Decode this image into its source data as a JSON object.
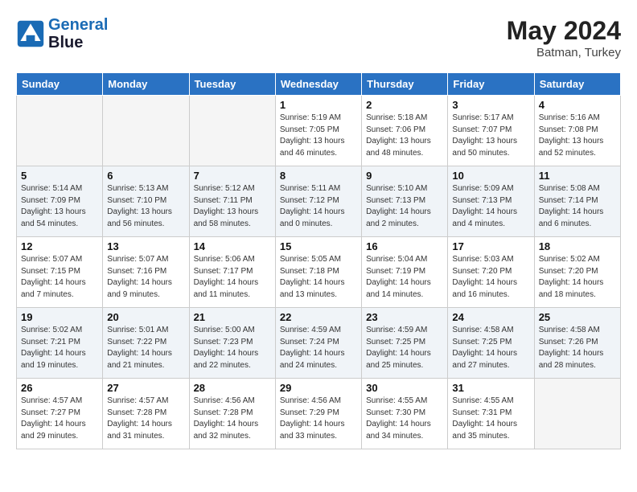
{
  "header": {
    "logo_line1": "General",
    "logo_line2": "Blue",
    "month_year": "May 2024",
    "location": "Batman, Turkey"
  },
  "weekdays": [
    "Sunday",
    "Monday",
    "Tuesday",
    "Wednesday",
    "Thursday",
    "Friday",
    "Saturday"
  ],
  "weeks": [
    [
      {
        "day": "",
        "info": ""
      },
      {
        "day": "",
        "info": ""
      },
      {
        "day": "",
        "info": ""
      },
      {
        "day": "1",
        "info": "Sunrise: 5:19 AM\nSunset: 7:05 PM\nDaylight: 13 hours\nand 46 minutes."
      },
      {
        "day": "2",
        "info": "Sunrise: 5:18 AM\nSunset: 7:06 PM\nDaylight: 13 hours\nand 48 minutes."
      },
      {
        "day": "3",
        "info": "Sunrise: 5:17 AM\nSunset: 7:07 PM\nDaylight: 13 hours\nand 50 minutes."
      },
      {
        "day": "4",
        "info": "Sunrise: 5:16 AM\nSunset: 7:08 PM\nDaylight: 13 hours\nand 52 minutes."
      }
    ],
    [
      {
        "day": "5",
        "info": "Sunrise: 5:14 AM\nSunset: 7:09 PM\nDaylight: 13 hours\nand 54 minutes."
      },
      {
        "day": "6",
        "info": "Sunrise: 5:13 AM\nSunset: 7:10 PM\nDaylight: 13 hours\nand 56 minutes."
      },
      {
        "day": "7",
        "info": "Sunrise: 5:12 AM\nSunset: 7:11 PM\nDaylight: 13 hours\nand 58 minutes."
      },
      {
        "day": "8",
        "info": "Sunrise: 5:11 AM\nSunset: 7:12 PM\nDaylight: 14 hours\nand 0 minutes."
      },
      {
        "day": "9",
        "info": "Sunrise: 5:10 AM\nSunset: 7:13 PM\nDaylight: 14 hours\nand 2 minutes."
      },
      {
        "day": "10",
        "info": "Sunrise: 5:09 AM\nSunset: 7:13 PM\nDaylight: 14 hours\nand 4 minutes."
      },
      {
        "day": "11",
        "info": "Sunrise: 5:08 AM\nSunset: 7:14 PM\nDaylight: 14 hours\nand 6 minutes."
      }
    ],
    [
      {
        "day": "12",
        "info": "Sunrise: 5:07 AM\nSunset: 7:15 PM\nDaylight: 14 hours\nand 7 minutes."
      },
      {
        "day": "13",
        "info": "Sunrise: 5:07 AM\nSunset: 7:16 PM\nDaylight: 14 hours\nand 9 minutes."
      },
      {
        "day": "14",
        "info": "Sunrise: 5:06 AM\nSunset: 7:17 PM\nDaylight: 14 hours\nand 11 minutes."
      },
      {
        "day": "15",
        "info": "Sunrise: 5:05 AM\nSunset: 7:18 PM\nDaylight: 14 hours\nand 13 minutes."
      },
      {
        "day": "16",
        "info": "Sunrise: 5:04 AM\nSunset: 7:19 PM\nDaylight: 14 hours\nand 14 minutes."
      },
      {
        "day": "17",
        "info": "Sunrise: 5:03 AM\nSunset: 7:20 PM\nDaylight: 14 hours\nand 16 minutes."
      },
      {
        "day": "18",
        "info": "Sunrise: 5:02 AM\nSunset: 7:20 PM\nDaylight: 14 hours\nand 18 minutes."
      }
    ],
    [
      {
        "day": "19",
        "info": "Sunrise: 5:02 AM\nSunset: 7:21 PM\nDaylight: 14 hours\nand 19 minutes."
      },
      {
        "day": "20",
        "info": "Sunrise: 5:01 AM\nSunset: 7:22 PM\nDaylight: 14 hours\nand 21 minutes."
      },
      {
        "day": "21",
        "info": "Sunrise: 5:00 AM\nSunset: 7:23 PM\nDaylight: 14 hours\nand 22 minutes."
      },
      {
        "day": "22",
        "info": "Sunrise: 4:59 AM\nSunset: 7:24 PM\nDaylight: 14 hours\nand 24 minutes."
      },
      {
        "day": "23",
        "info": "Sunrise: 4:59 AM\nSunset: 7:25 PM\nDaylight: 14 hours\nand 25 minutes."
      },
      {
        "day": "24",
        "info": "Sunrise: 4:58 AM\nSunset: 7:25 PM\nDaylight: 14 hours\nand 27 minutes."
      },
      {
        "day": "25",
        "info": "Sunrise: 4:58 AM\nSunset: 7:26 PM\nDaylight: 14 hours\nand 28 minutes."
      }
    ],
    [
      {
        "day": "26",
        "info": "Sunrise: 4:57 AM\nSunset: 7:27 PM\nDaylight: 14 hours\nand 29 minutes."
      },
      {
        "day": "27",
        "info": "Sunrise: 4:57 AM\nSunset: 7:28 PM\nDaylight: 14 hours\nand 31 minutes."
      },
      {
        "day": "28",
        "info": "Sunrise: 4:56 AM\nSunset: 7:28 PM\nDaylight: 14 hours\nand 32 minutes."
      },
      {
        "day": "29",
        "info": "Sunrise: 4:56 AM\nSunset: 7:29 PM\nDaylight: 14 hours\nand 33 minutes."
      },
      {
        "day": "30",
        "info": "Sunrise: 4:55 AM\nSunset: 7:30 PM\nDaylight: 14 hours\nand 34 minutes."
      },
      {
        "day": "31",
        "info": "Sunrise: 4:55 AM\nSunset: 7:31 PM\nDaylight: 14 hours\nand 35 minutes."
      },
      {
        "day": "",
        "info": ""
      }
    ]
  ],
  "shaded_rows": [
    1,
    3
  ]
}
